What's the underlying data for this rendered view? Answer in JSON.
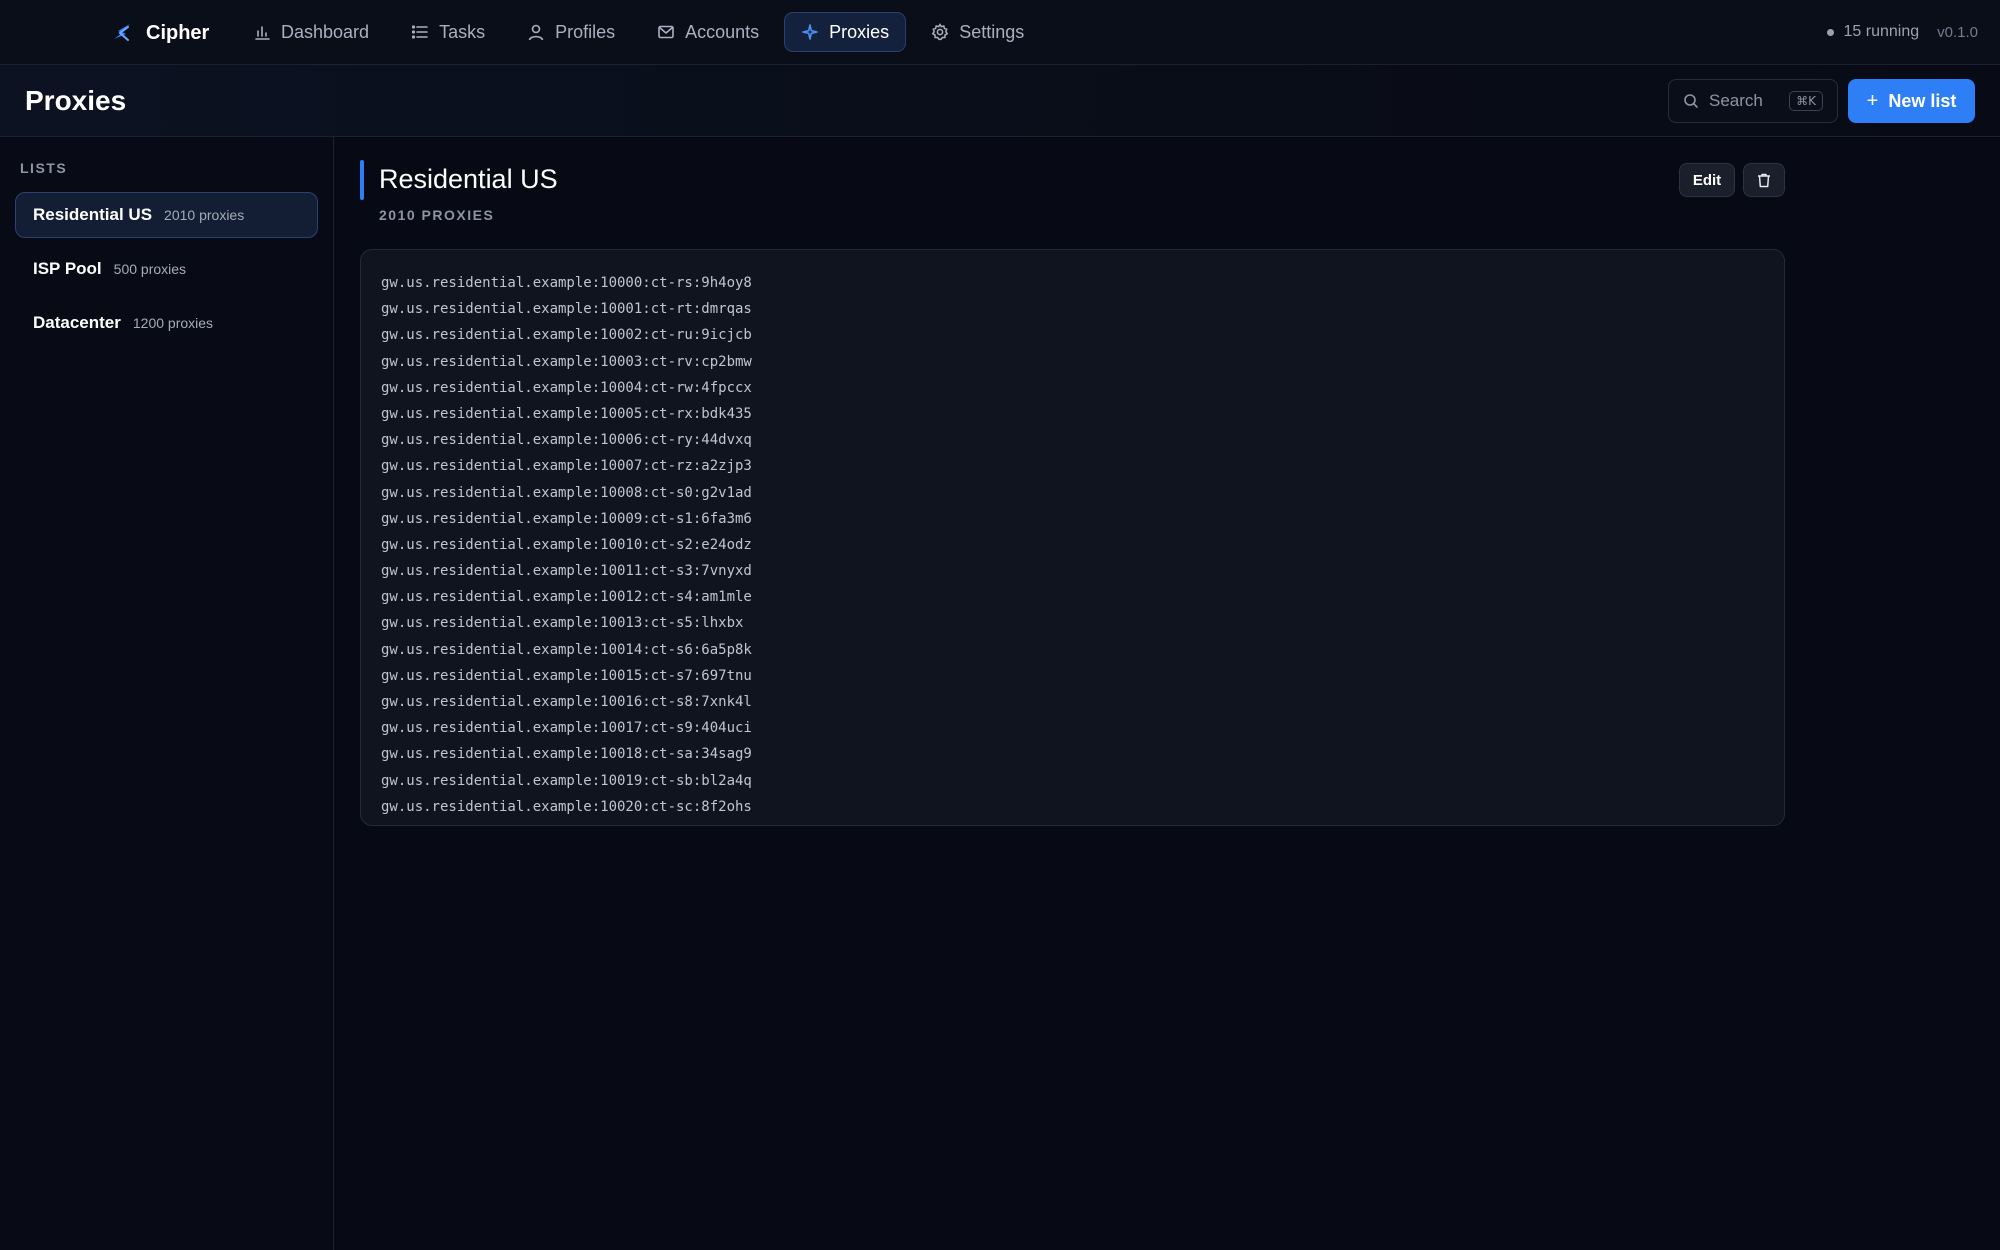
{
  "app": {
    "brand": "Cipher",
    "running": "15 running",
    "version": "v0.1.0"
  },
  "nav": [
    {
      "label": "Dashboard",
      "icon": "bar-chart-icon",
      "active": false
    },
    {
      "label": "Tasks",
      "icon": "list-icon",
      "active": false
    },
    {
      "label": "Profiles",
      "icon": "user-icon",
      "active": false
    },
    {
      "label": "Accounts",
      "icon": "mail-icon",
      "active": false
    },
    {
      "label": "Proxies",
      "icon": "sparkle-icon",
      "active": true
    },
    {
      "label": "Settings",
      "icon": "gear-icon",
      "active": false
    }
  ],
  "header": {
    "title": "Proxies",
    "search_label": "Search",
    "search_shortcut": "⌘K",
    "new_list_label": "New list"
  },
  "sidebar": {
    "section_label": "LISTS",
    "items": [
      {
        "name": "Residential US",
        "count": "2010 proxies",
        "active": true
      },
      {
        "name": "ISP Pool",
        "count": "500 proxies",
        "active": false
      },
      {
        "name": "Datacenter",
        "count": "1200 proxies",
        "active": false
      }
    ]
  },
  "main": {
    "title": "Residential US",
    "subtitle": "2010 PROXIES",
    "edit_label": "Edit",
    "proxies": [
      "gw.us.residential.example:10000:ct-rs:9h4oy8",
      "gw.us.residential.example:10001:ct-rt:dmrqas",
      "gw.us.residential.example:10002:ct-ru:9icjcb",
      "gw.us.residential.example:10003:ct-rv:cp2bmw",
      "gw.us.residential.example:10004:ct-rw:4fpccx",
      "gw.us.residential.example:10005:ct-rx:bdk435",
      "gw.us.residential.example:10006:ct-ry:44dvxq",
      "gw.us.residential.example:10007:ct-rz:a2zjp3",
      "gw.us.residential.example:10008:ct-s0:g2v1ad",
      "gw.us.residential.example:10009:ct-s1:6fa3m6",
      "gw.us.residential.example:10010:ct-s2:e24odz",
      "gw.us.residential.example:10011:ct-s3:7vnyxd",
      "gw.us.residential.example:10012:ct-s4:am1mle",
      "gw.us.residential.example:10013:ct-s5:lhxbx",
      "gw.us.residential.example:10014:ct-s6:6a5p8k",
      "gw.us.residential.example:10015:ct-s7:697tnu",
      "gw.us.residential.example:10016:ct-s8:7xnk4l",
      "gw.us.residential.example:10017:ct-s9:404uci",
      "gw.us.residential.example:10018:ct-sa:34sag9",
      "gw.us.residential.example:10019:ct-sb:bl2a4q",
      "gw.us.residential.example:10020:ct-sc:8f2ohs"
    ]
  },
  "colors": {
    "accent": "#2e7ff6",
    "background": "#070a14"
  }
}
